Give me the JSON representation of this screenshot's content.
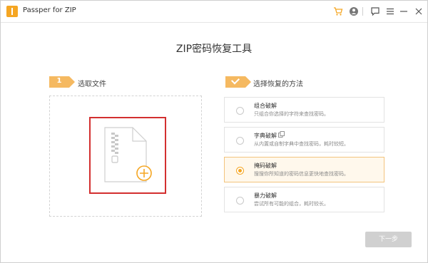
{
  "window": {
    "title": "Passper for ZIP"
  },
  "main": {
    "title": "ZIP密码恢复工具"
  },
  "step1": {
    "number": "1",
    "label": "选取文件"
  },
  "step2": {
    "label": "选择恢复的方法"
  },
  "options": [
    {
      "title": "组合破解",
      "desc": "只组合你选择的字符来查找密码。",
      "selected": false
    },
    {
      "title": "字典破解",
      "desc": "从内置或自制字典中查找密码，耗时较短。",
      "selected": false
    },
    {
      "title": "掩码破解",
      "desc": "搜搜你所知道的密码信息更快地查找密码。",
      "selected": true
    },
    {
      "title": "暴力破解",
      "desc": "尝试所有可能的组合，耗时较长。",
      "selected": false
    }
  ],
  "footer": {
    "next_label": "下一步"
  },
  "colors": {
    "accent": "#f5a623",
    "badge": "#f5b961",
    "highlight_border": "#d32f2f",
    "disabled_button": "#d0d0d0"
  },
  "icons": [
    "app-logo-icon",
    "cart-icon",
    "user-icon",
    "feedback-icon",
    "menu-icon",
    "minimize-icon",
    "close-icon",
    "zip-file-icon",
    "add-file-icon",
    "copy-icon",
    "check-icon"
  ]
}
